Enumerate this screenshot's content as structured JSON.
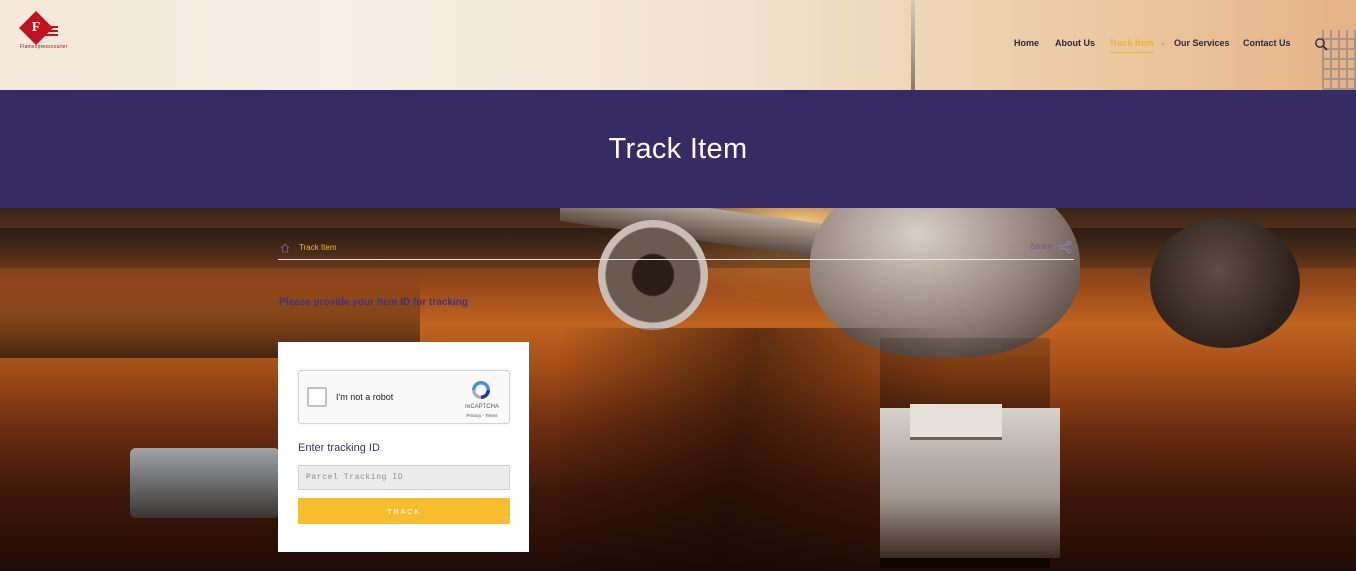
{
  "header": {
    "logo_text": "Flamexpresscourier",
    "nav": [
      {
        "label": "Home",
        "active": false
      },
      {
        "label": "About Us",
        "active": false
      },
      {
        "label": "Track Item",
        "active": true
      },
      {
        "label": "Our Services",
        "active": false
      },
      {
        "label": "Contact Us",
        "active": false
      }
    ],
    "search_icon": "search-icon"
  },
  "page": {
    "title": "Track Item"
  },
  "breadcrumb": {
    "home_icon": "home-icon",
    "current": "Track Item",
    "share_label": "Share",
    "share_icon": "share-icon"
  },
  "prompt": "Please provide your Item ID for tracking",
  "tracking_form": {
    "recaptcha": {
      "label": "I'm not a robot",
      "brand": "reCAPTCHA",
      "links": "Privacy - Terms",
      "checked": false
    },
    "field_label": "Enter tracking ID",
    "input_placeholder": "Parcel Tracking ID",
    "input_value": "",
    "button_label": "TRACK"
  },
  "colors": {
    "title_band": "#362b65",
    "accent": "#f0b429",
    "button": "#f8bd2f",
    "logo_red": "#c1121f"
  }
}
